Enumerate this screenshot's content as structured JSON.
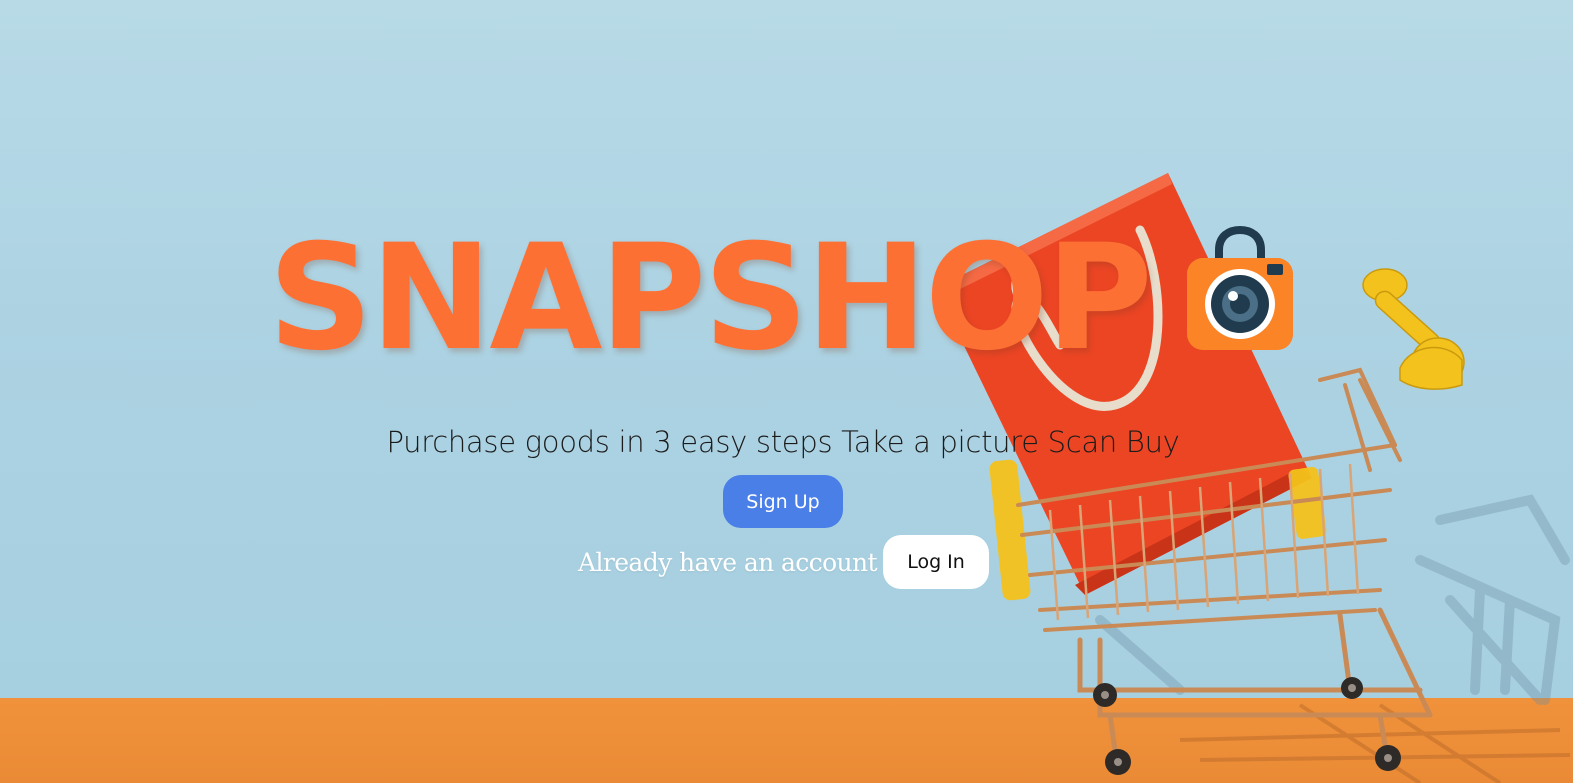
{
  "brand": {
    "title": "SNAPSHOP",
    "logo_icon": "shopping-bag-camera-icon",
    "title_color": "#fd7034"
  },
  "hero": {
    "tagline": "Purchase goods in 3 easy steps Take a picture Scan Buy",
    "background_image": "shopping-cart-with-bag-illustration"
  },
  "actions": {
    "signup_label": "Sign Up",
    "login_prompt": "Already have an account",
    "login_label": "Log In"
  },
  "colors": {
    "wall": "#add3e3",
    "floor": "#ee8e38",
    "primary_button": "#4a7fe8",
    "secondary_button": "#ffffff"
  }
}
